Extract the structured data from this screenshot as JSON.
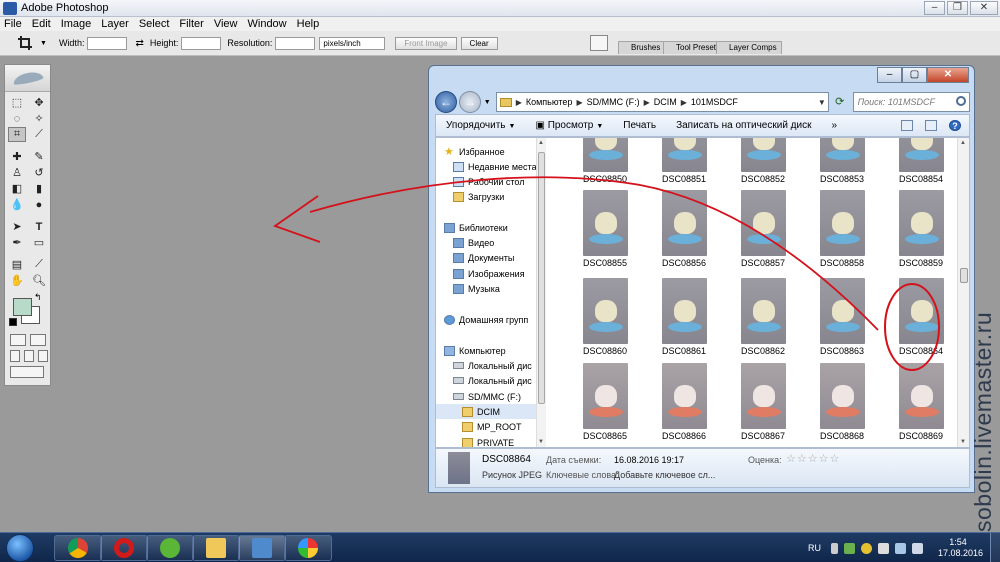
{
  "photoshop": {
    "title": "Adobe Photoshop",
    "menu": [
      "File",
      "Edit",
      "Image",
      "Layer",
      "Select",
      "Filter",
      "View",
      "Window",
      "Help"
    ],
    "options": {
      "width_label": "Width:",
      "height_label": "Height:",
      "resolution_label": "Resolution:",
      "units_value": "pixels/inch",
      "front_image_label": "Front Image",
      "clear_label": "Clear"
    },
    "palette_tabs": [
      "Brushes",
      "Tool Presets",
      "Layer Comps"
    ],
    "colors": {
      "foreground": "#b8dbc9",
      "background": "#ffffff"
    }
  },
  "explorer": {
    "breadcrumb": [
      "Компьютер",
      "SD/MMC (F:)",
      "DCIM",
      "101MSDCF"
    ],
    "search_placeholder": "Поиск: 101MSDCF",
    "toolbar": {
      "organize": "Упорядочить",
      "view": "Просмотр",
      "print": "Печать",
      "burn": "Записать на оптический диск",
      "more": "»"
    },
    "nav": [
      {
        "label": "Избранное",
        "icon": "star-icon",
        "level": 0
      },
      {
        "label": "Недавние места",
        "icon": "recent-places-icon",
        "level": 1
      },
      {
        "label": "Рабочий стол",
        "icon": "desktop-icon",
        "level": 1
      },
      {
        "label": "Загрузки",
        "icon": "downloads-folder-icon",
        "level": 1
      },
      {
        "label": "Библиотеки",
        "icon": "libraries-icon",
        "level": 0
      },
      {
        "label": "Видео",
        "icon": "video-library-icon",
        "level": 1
      },
      {
        "label": "Документы",
        "icon": "documents-library-icon",
        "level": 1
      },
      {
        "label": "Изображения",
        "icon": "pictures-library-icon",
        "level": 1
      },
      {
        "label": "Музыка",
        "icon": "music-library-icon",
        "level": 1
      },
      {
        "label": "Домашняя групп",
        "icon": "homegroup-icon",
        "level": 0
      },
      {
        "label": "Компьютер",
        "icon": "computer-icon",
        "level": 0
      },
      {
        "label": "Локальный дис",
        "icon": "local-disk-icon",
        "level": 1
      },
      {
        "label": "Локальный дис",
        "icon": "local-disk-icon",
        "level": 1
      },
      {
        "label": "SD/MMC (F:)",
        "icon": "sd-card-icon",
        "level": 1
      },
      {
        "label": "DCIM",
        "icon": "folder-icon",
        "level": 2,
        "selected": true
      },
      {
        "label": "MP_ROOT",
        "icon": "folder-icon",
        "level": 2
      },
      {
        "label": "PRIVATE",
        "icon": "folder-icon",
        "level": 2
      }
    ],
    "files": [
      "DSC08850",
      "DSC08851",
      "DSC08852",
      "DSC08853",
      "DSC08854",
      "DSC08855",
      "DSC08856",
      "DSC08857",
      "DSC08858",
      "DSC08859",
      "DSC08860",
      "DSC08861",
      "DSC08862",
      "DSC08863",
      "DSC08864",
      "DSC08865",
      "DSC08866",
      "DSC08867",
      "DSC08868",
      "DSC08869"
    ],
    "selected_file": "DSC08864",
    "details": {
      "name": "DSC08864",
      "type": "Рисунок JPEG",
      "date_label": "Дата съемки:",
      "date_value": "16.08.2016 19:17",
      "keywords_label": "Ключевые слова:",
      "keywords_value": "Добавьте ключевое сл...",
      "rating_label": "Оценка:",
      "rating_stars": "☆☆☆☆☆"
    }
  },
  "taskbar": {
    "language": "RU",
    "time": "1:54",
    "date": "17.08.2016"
  },
  "watermark": "sobolin.livemaster.ru"
}
